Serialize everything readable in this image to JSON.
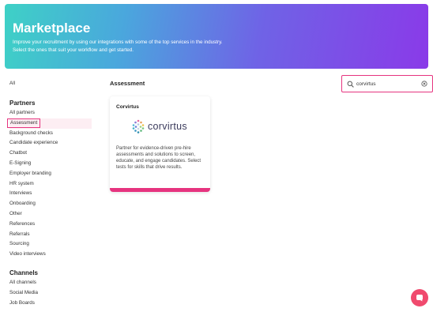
{
  "hero": {
    "title": "Marketplace",
    "line1": "Improve your recruitment by using our integrations with some of the top services in the industry.",
    "line2": "Select the ones that suit your workflow and get started."
  },
  "sidebar": {
    "all": "All",
    "partners_heading": "Partners",
    "partners": [
      "All partners",
      "Assessment",
      "Background checks",
      "Candidate experience",
      "Chatbot",
      "E-Signing",
      "Employer branding",
      "HR system",
      "Interviews",
      "Onboarding",
      "Other",
      "References",
      "Referrals",
      "Sourcing",
      "Video interviews"
    ],
    "channels_heading": "Channels",
    "channels": [
      "All channels",
      "Social Media",
      "Job Boards"
    ]
  },
  "main": {
    "title": "Assessment"
  },
  "search": {
    "value": "corvirtus"
  },
  "card": {
    "title": "Corvirtus",
    "logo_text": "corvirtus",
    "description": "Partner for evidence-driven pre-hire assessments and solutions to screen, educate, and engage candidates. Select tests for skills that drive results."
  },
  "colors": {
    "accent": "#e6347f",
    "chat": "#f04a6e"
  },
  "icons": {
    "search": "search-icon",
    "clear": "clear-circle-icon",
    "chat": "chat-icon",
    "logo": "corvirtus-hex-logo"
  }
}
